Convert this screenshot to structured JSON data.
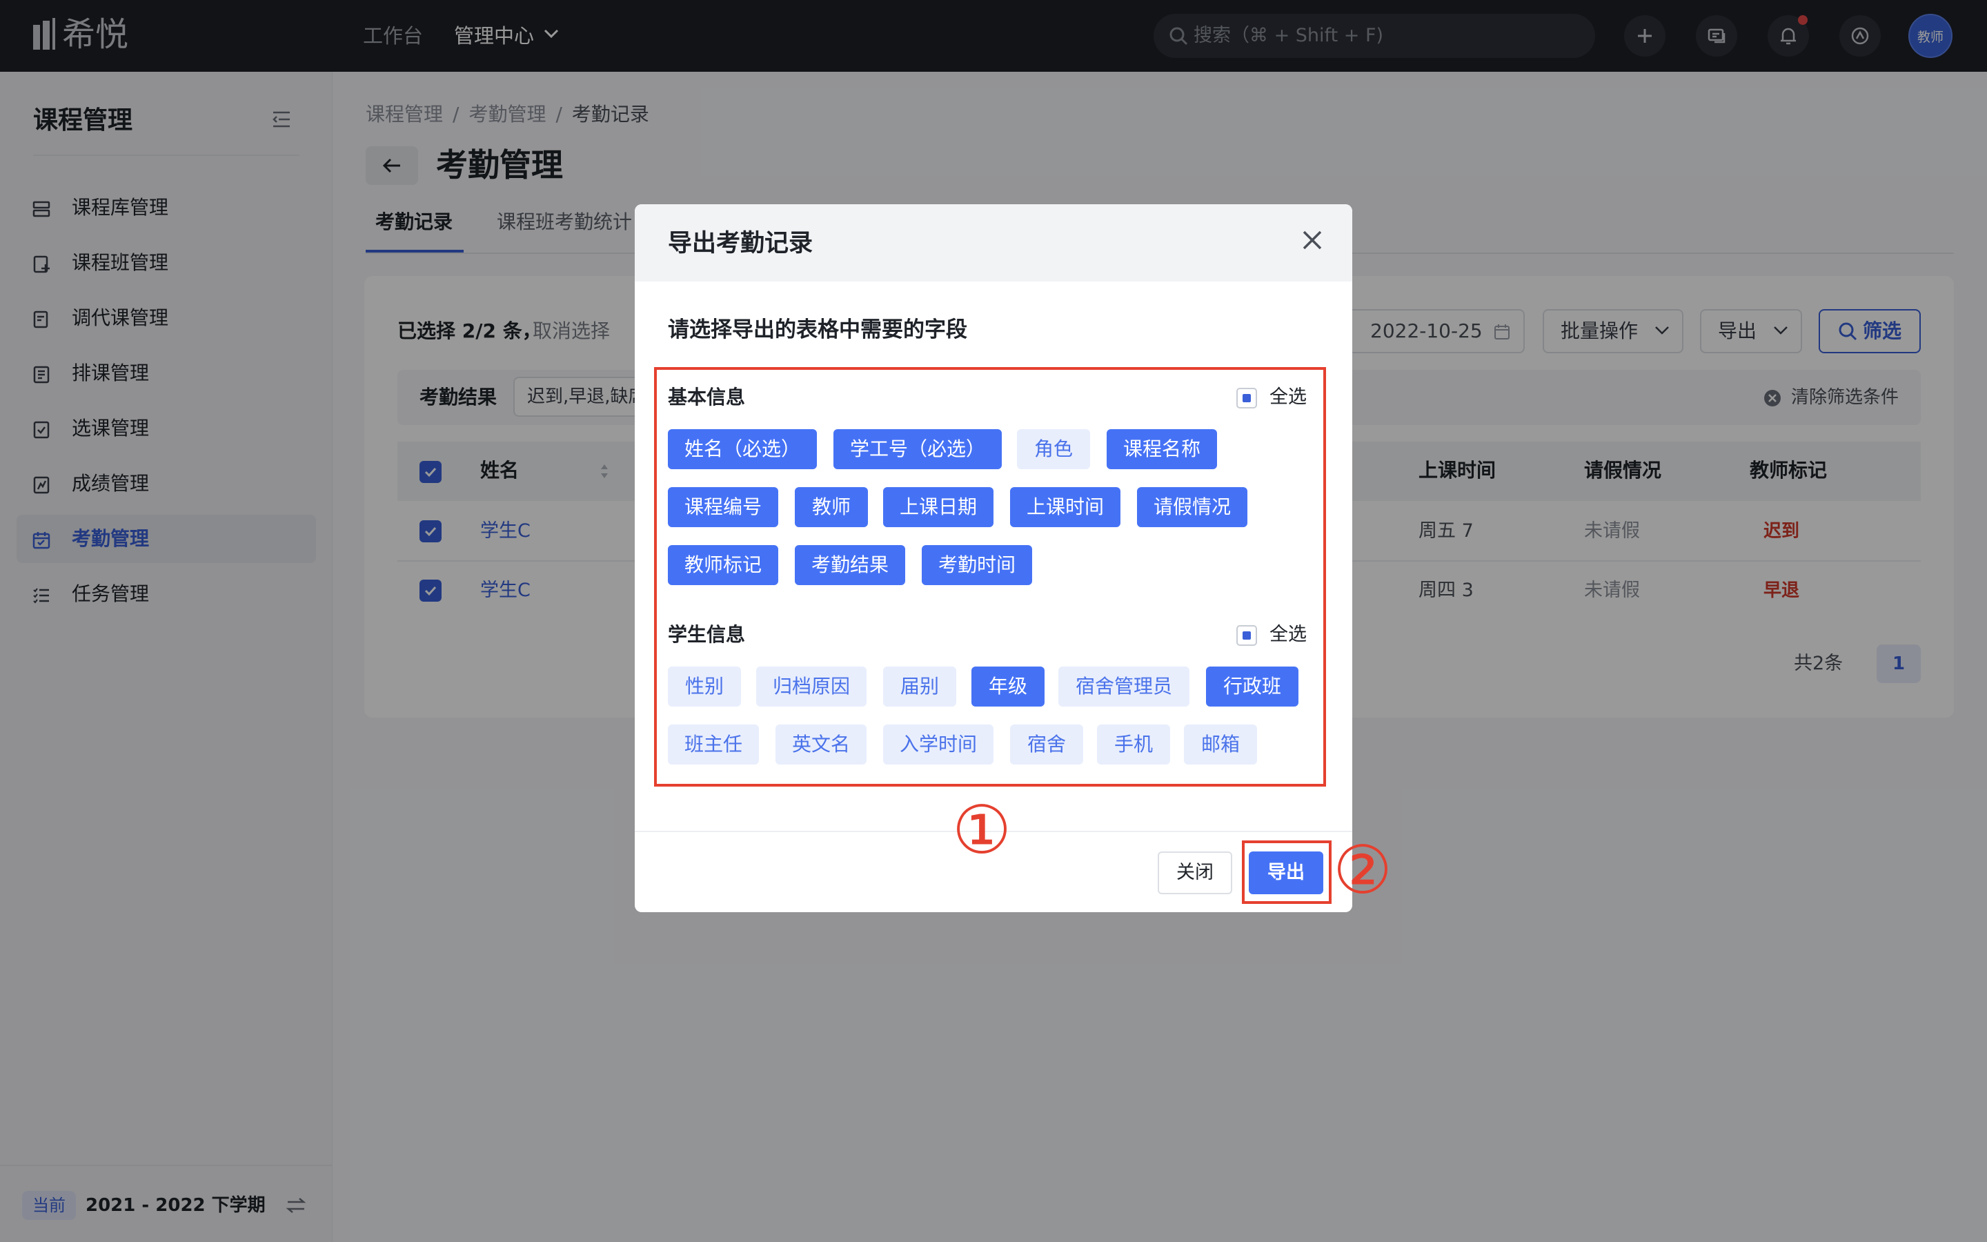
{
  "topbar": {
    "logo_text": "希悦",
    "nav_workspace": "工作台",
    "nav_admin": "管理中心",
    "search_placeholder": "搜索（⌘ + Shift + F)",
    "avatar_label": "教师"
  },
  "sidebar": {
    "title": "课程管理",
    "items": [
      {
        "label": "课程库管理",
        "icon": "layers-icon"
      },
      {
        "label": "课程班管理",
        "icon": "class-icon"
      },
      {
        "label": "调代课管理",
        "icon": "swap-doc-icon"
      },
      {
        "label": "排课管理",
        "icon": "schedule-icon"
      },
      {
        "label": "选课管理",
        "icon": "checklist-icon"
      },
      {
        "label": "成绩管理",
        "icon": "grade-icon"
      },
      {
        "label": "考勤管理",
        "icon": "calendar-icon",
        "active": true
      },
      {
        "label": "任务管理",
        "icon": "task-list-icon"
      }
    ],
    "term_badge": "当前",
    "term": "2021 - 2022 下学期"
  },
  "main": {
    "breadcrumb": [
      "课程管理",
      "考勤管理",
      "考勤记录"
    ],
    "page_title": "考勤管理",
    "tabs": [
      "考勤记录",
      "课程班考勤统计"
    ],
    "selection_info": "已选择 2/2 条，",
    "cancel_selection": "取消选择",
    "date_value": "2022-10-25",
    "batch_label": "批量操作",
    "export_label": "导出",
    "filter_label": "筛选",
    "filter_row": {
      "label": "考勤结果",
      "value": "迟到,早退,缺席",
      "clear": "清除筛选条件"
    },
    "table": {
      "headers": {
        "name": "姓名",
        "time": "上课时间",
        "leave": "请假情况",
        "mark": "教师标记"
      },
      "rows": [
        {
          "name": "学生C",
          "time": "周五 7",
          "leave": "未请假",
          "mark": "迟到"
        },
        {
          "name": "学生C",
          "time": "周四 3",
          "leave": "未请假",
          "mark": "早退"
        }
      ]
    },
    "total": "共2条",
    "page": "1"
  },
  "dialog": {
    "title": "导出考勤记录",
    "prompt": "请选择导出的表格中需要的字段",
    "select_all": "全选",
    "sections": [
      {
        "title": "基本信息",
        "fields": [
          {
            "label": "姓名（必选）",
            "selected": true
          },
          {
            "label": "学工号（必选）",
            "selected": true
          },
          {
            "label": "角色",
            "selected": false
          },
          {
            "label": "课程名称",
            "selected": true
          },
          {
            "label": "课程编号",
            "selected": true
          },
          {
            "label": "教师",
            "selected": true
          },
          {
            "label": "上课日期",
            "selected": true
          },
          {
            "label": "上课时间",
            "selected": true
          },
          {
            "label": "请假情况",
            "selected": true
          },
          {
            "label": "教师标记",
            "selected": true
          },
          {
            "label": "考勤结果",
            "selected": true
          },
          {
            "label": "考勤时间",
            "selected": true
          }
        ]
      },
      {
        "title": "学生信息",
        "fields": [
          {
            "label": "性别",
            "selected": false
          },
          {
            "label": "归档原因",
            "selected": false
          },
          {
            "label": "届别",
            "selected": false
          },
          {
            "label": "年级",
            "selected": true
          },
          {
            "label": "宿舍管理员",
            "selected": false
          },
          {
            "label": "行政班",
            "selected": true
          },
          {
            "label": "班主任",
            "selected": false
          },
          {
            "label": "英文名",
            "selected": false
          },
          {
            "label": "入学时间",
            "selected": false
          },
          {
            "label": "宿舍",
            "selected": false
          },
          {
            "label": "手机",
            "selected": false
          },
          {
            "label": "邮箱",
            "selected": false
          }
        ]
      }
    ],
    "close_label": "关闭",
    "export_label": "导出"
  },
  "annotations": {
    "step1": "①",
    "step2": "②"
  },
  "colors": {
    "primary": "#4572f5",
    "annotation": "#e5402f",
    "topbar": "#1f2127"
  }
}
